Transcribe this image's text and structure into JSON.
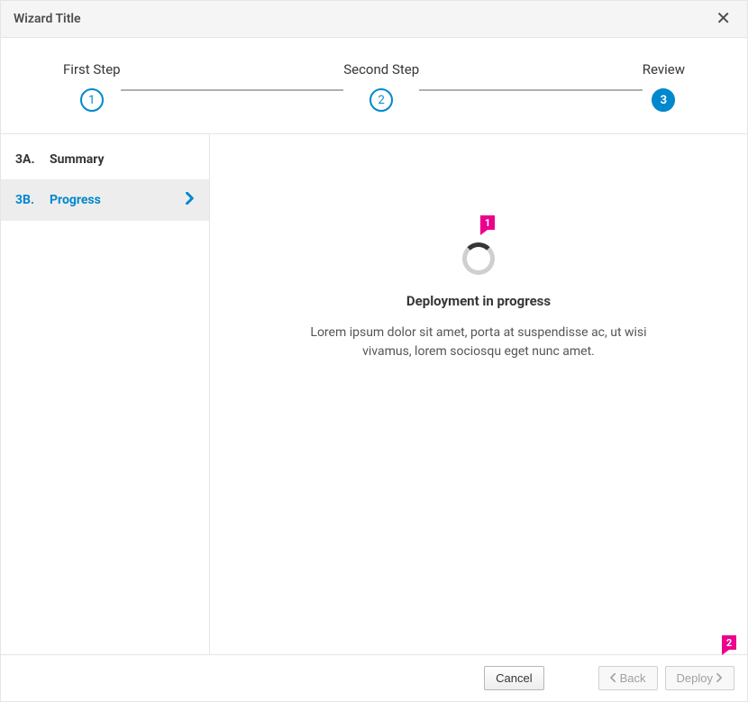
{
  "header": {
    "title": "Wizard Title"
  },
  "steps": [
    {
      "label": "First Step",
      "num": "1",
      "active": false
    },
    {
      "label": "Second Step",
      "num": "2",
      "active": false
    },
    {
      "label": "Review",
      "num": "3",
      "active": true
    }
  ],
  "sidebar": {
    "items": [
      {
        "prefix": "3A.",
        "label": "Summary",
        "active": false
      },
      {
        "prefix": "3B.",
        "label": "Progress",
        "active": true
      }
    ]
  },
  "main": {
    "status_title": "Deployment in progress",
    "status_desc": "Lorem ipsum dolor sit amet, porta at suspendisse ac, ut wisi vivamus, lorem sociosqu eget nunc amet."
  },
  "footer": {
    "cancel": "Cancel",
    "back": "Back",
    "deploy": "Deploy"
  },
  "annotations": {
    "spinner_callout": "1",
    "deploy_callout": "2"
  }
}
